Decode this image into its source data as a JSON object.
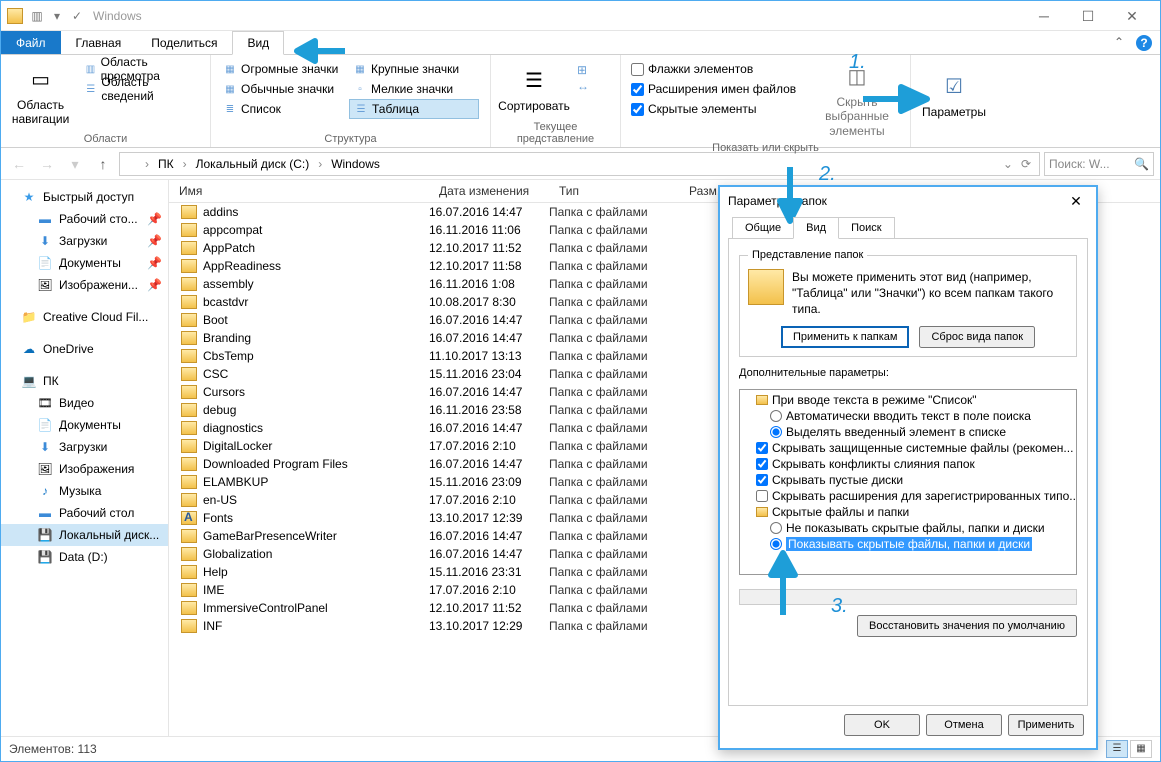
{
  "window": {
    "title": "Windows"
  },
  "menutabs": {
    "file": "Файл",
    "home": "Главная",
    "share": "Поделиться",
    "view": "Вид"
  },
  "ribbon": {
    "panes_caption": "Области",
    "layout_caption": "Структура",
    "current_caption": "Текущее представление",
    "showhide_caption": "Показать или скрыть",
    "nav": "Область\nнавигации",
    "preview": "Область просмотра",
    "details": "Область сведений",
    "icon_huge": "Огромные значки",
    "icon_large": "Крупные значки",
    "icon_medium": "Обычные значки",
    "icon_small": "Мелкие значки",
    "icon_list": "Список",
    "icon_table": "Таблица",
    "sort": "Сортировать",
    "chk_boxes": "Флажки элементов",
    "chk_ext": "Расширения имен файлов",
    "chk_hidden": "Скрытые элементы",
    "hide_sel": "Скрыть выбранные\nэлементы",
    "options": "Параметры"
  },
  "breadcrumb": {
    "pc": "ПК",
    "disk": "Локальный диск (C:)",
    "folder": "Windows"
  },
  "search_placeholder": "Поиск: W...",
  "columns": {
    "name": "Имя",
    "date": "Дата изменения",
    "type": "Тип",
    "size": "Разм..."
  },
  "nav": {
    "quick": "Быстрый доступ",
    "desktop": "Рабочий сто...",
    "downloads": "Загрузки",
    "documents": "Документы",
    "pictures": "Изображени...",
    "creative": "Creative Cloud Fil...",
    "onedrive": "OneDrive",
    "pc": "ПК",
    "video": "Видео",
    "docs2": "Документы",
    "dl2": "Загрузки",
    "pics2": "Изображения",
    "music": "Музыка",
    "desk2": "Рабочий стол",
    "localc": "Локальный диск...",
    "datad": "Data (D:)"
  },
  "type_folder": "Папка с файлами",
  "files": [
    {
      "n": "addins",
      "d": "16.07.2016 14:47"
    },
    {
      "n": "appcompat",
      "d": "16.11.2016 11:06"
    },
    {
      "n": "AppPatch",
      "d": "12.10.2017 11:52"
    },
    {
      "n": "AppReadiness",
      "d": "12.10.2017 11:58"
    },
    {
      "n": "assembly",
      "d": "16.11.2016 1:08"
    },
    {
      "n": "bcastdvr",
      "d": "10.08.2017 8:30"
    },
    {
      "n": "Boot",
      "d": "16.07.2016 14:47"
    },
    {
      "n": "Branding",
      "d": "16.07.2016 14:47"
    },
    {
      "n": "CbsTemp",
      "d": "11.10.2017 13:13"
    },
    {
      "n": "CSC",
      "d": "15.11.2016 23:04"
    },
    {
      "n": "Cursors",
      "d": "16.07.2016 14:47"
    },
    {
      "n": "debug",
      "d": "16.11.2016 23:58"
    },
    {
      "n": "diagnostics",
      "d": "16.07.2016 14:47"
    },
    {
      "n": "DigitalLocker",
      "d": "17.07.2016 2:10"
    },
    {
      "n": "Downloaded Program Files",
      "d": "16.07.2016 14:47"
    },
    {
      "n": "ELAMBKUP",
      "d": "15.11.2016 23:09"
    },
    {
      "n": "en-US",
      "d": "17.07.2016 2:10"
    },
    {
      "n": "Fonts",
      "d": "13.10.2017 12:39",
      "ico": "A"
    },
    {
      "n": "GameBarPresenceWriter",
      "d": "16.07.2016 14:47"
    },
    {
      "n": "Globalization",
      "d": "16.07.2016 14:47"
    },
    {
      "n": "Help",
      "d": "15.11.2016 23:31"
    },
    {
      "n": "IME",
      "d": "17.07.2016 2:10"
    },
    {
      "n": "ImmersiveControlPanel",
      "d": "12.10.2017 11:52"
    },
    {
      "n": "INF",
      "d": "13.10.2017 12:29"
    }
  ],
  "status": {
    "count": "Элементов: 113"
  },
  "dialog": {
    "title": "Параметры папок",
    "tab_general": "Общие",
    "tab_view": "Вид",
    "tab_search": "Поиск",
    "fv_legend": "Представление папок",
    "fv_text": "Вы можете применить этот вид (например, \"Таблица\" или \"Значки\") ко всем папкам такого типа.",
    "btn_apply_folders": "Применить к папкам",
    "btn_reset_folders": "Сброс вида папок",
    "adv_label": "Дополнительные параметры:",
    "adv": {
      "typing_header": "При вводе текста в режиме \"Список\"",
      "typing_auto": "Автоматически вводить текст в поле поиска",
      "typing_select": "Выделять введенный элемент в списке",
      "hide_protected": "Скрывать защищенные системные файлы (рекомен...",
      "hide_merge": "Скрывать конфликты слияния папок",
      "hide_empty": "Скрывать пустые диски",
      "hide_ext": "Скрывать расширения для зарегистрированных типо...",
      "hidden_header": "Скрытые файлы и папки",
      "hidden_no": "Не показывать скрытые файлы, папки и диски",
      "hidden_yes": "Показывать скрытые файлы, папки и диски"
    },
    "btn_defaults": "Восстановить значения по умолчанию",
    "btn_ok": "OK",
    "btn_cancel": "Отмена",
    "btn_apply": "Применить"
  },
  "anno": {
    "n1": "1.",
    "n2": "2.",
    "n3": "3."
  }
}
